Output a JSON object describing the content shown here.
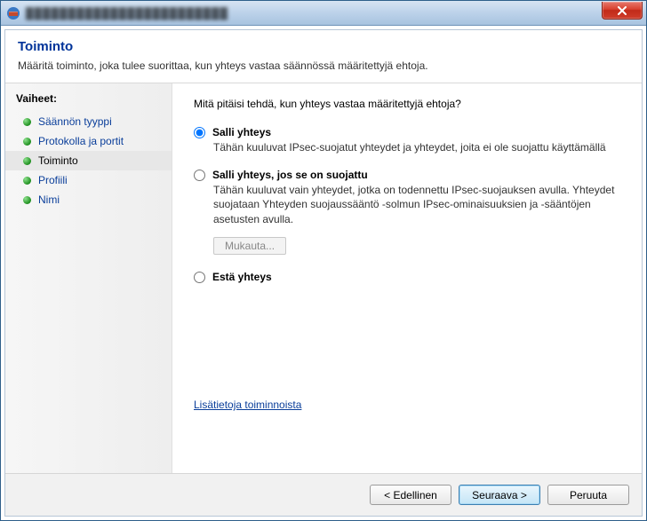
{
  "window": {
    "title": "████████████████████████"
  },
  "header": {
    "title": "Toiminto",
    "subtitle": "Määritä toiminto, joka tulee suorittaa, kun yhteys vastaa säännössä määritettyjä ehtoja."
  },
  "sidebar": {
    "title": "Vaiheet:",
    "steps": [
      {
        "label": "Säännön tyyppi",
        "current": false
      },
      {
        "label": "Protokolla ja portit",
        "current": false
      },
      {
        "label": "Toiminto",
        "current": true
      },
      {
        "label": "Profiili",
        "current": false
      },
      {
        "label": "Nimi",
        "current": false
      }
    ]
  },
  "content": {
    "prompt": "Mitä pitäisi tehdä, kun yhteys vastaa määritettyjä ehtoja?",
    "options": [
      {
        "label": "Salli yhteys",
        "desc": "Tähän kuuluvat IPsec-suojatut yhteydet ja yhteydet, joita ei ole suojattu käyttämällä",
        "checked": true
      },
      {
        "label": "Salli yhteys, jos se on suojattu",
        "desc": "Tähän kuuluvat vain yhteydet, jotka on todennettu IPsec-suojauksen avulla. Yhteydet suojataan Yhteyden suojaussääntö -solmun IPsec-ominaisuuksien ja -sääntöjen asetusten avulla.",
        "checked": false,
        "customize": "Mukauta..."
      },
      {
        "label": "Estä yhteys",
        "desc": "",
        "checked": false
      }
    ],
    "infoLink": "Lisätietoja toiminnoista"
  },
  "footer": {
    "back": "< Edellinen",
    "next": "Seuraava >",
    "cancel": "Peruuta"
  }
}
